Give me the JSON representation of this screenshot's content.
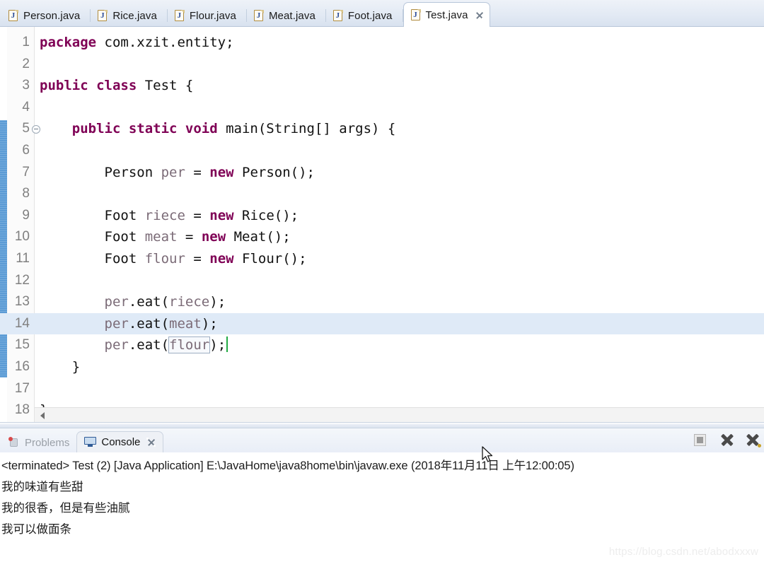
{
  "editor": {
    "tabs": [
      {
        "label": "Person.java",
        "icon": "java-file-icon",
        "active": false
      },
      {
        "label": "Rice.java",
        "icon": "java-file-icon",
        "active": false
      },
      {
        "label": "Flour.java",
        "icon": "java-file-icon",
        "active": false
      },
      {
        "label": "Meat.java",
        "icon": "java-file-icon",
        "active": false
      },
      {
        "label": "Foot.java",
        "icon": "java-file-icon",
        "active": false
      },
      {
        "label": "Test.java",
        "icon": "java-file-icon",
        "active": true,
        "close_icon": "close-icon"
      }
    ],
    "file_icon_letter": "J",
    "lines": [
      {
        "n": "1",
        "tokens": [
          {
            "t": "package",
            "c": "kw"
          },
          {
            "t": " com.xzit.entity;",
            "c": "pln"
          }
        ]
      },
      {
        "n": "2",
        "tokens": []
      },
      {
        "n": "3",
        "tokens": [
          {
            "t": "public class",
            "c": "kw"
          },
          {
            "t": " Test {",
            "c": "pln"
          }
        ]
      },
      {
        "n": "4",
        "tokens": []
      },
      {
        "n": "5",
        "fold": true,
        "tokens": [
          {
            "t": "    ",
            "c": "pln"
          },
          {
            "t": "public static void",
            "c": "kw"
          },
          {
            "t": " main(String[] args) {",
            "c": "pln"
          }
        ]
      },
      {
        "n": "6",
        "tokens": []
      },
      {
        "n": "7",
        "tokens": [
          {
            "t": "        Person ",
            "c": "pln"
          },
          {
            "t": "per",
            "c": "var"
          },
          {
            "t": " = ",
            "c": "pln"
          },
          {
            "t": "new",
            "c": "kw"
          },
          {
            "t": " Person();",
            "c": "pln"
          }
        ]
      },
      {
        "n": "8",
        "tokens": []
      },
      {
        "n": "9",
        "tokens": [
          {
            "t": "        Foot ",
            "c": "pln"
          },
          {
            "t": "riece",
            "c": "var"
          },
          {
            "t": " = ",
            "c": "pln"
          },
          {
            "t": "new",
            "c": "kw"
          },
          {
            "t": " Rice();",
            "c": "pln"
          }
        ]
      },
      {
        "n": "10",
        "tokens": [
          {
            "t": "        Foot ",
            "c": "pln"
          },
          {
            "t": "meat",
            "c": "var"
          },
          {
            "t": " = ",
            "c": "pln"
          },
          {
            "t": "new",
            "c": "kw"
          },
          {
            "t": " Meat();",
            "c": "pln"
          }
        ]
      },
      {
        "n": "11",
        "tokens": [
          {
            "t": "        Foot ",
            "c": "pln"
          },
          {
            "t": "flour",
            "c": "var"
          },
          {
            "t": " = ",
            "c": "pln"
          },
          {
            "t": "new",
            "c": "kw"
          },
          {
            "t": " Flour();",
            "c": "pln"
          }
        ]
      },
      {
        "n": "12",
        "tokens": []
      },
      {
        "n": "13",
        "tokens": [
          {
            "t": "        ",
            "c": "pln"
          },
          {
            "t": "per",
            "c": "var"
          },
          {
            "t": ".eat(",
            "c": "pln"
          },
          {
            "t": "riece",
            "c": "var"
          },
          {
            "t": ");",
            "c": "pln"
          }
        ]
      },
      {
        "n": "14",
        "highlight": true,
        "tokens": [
          {
            "t": "        ",
            "c": "pln"
          },
          {
            "t": "per",
            "c": "var"
          },
          {
            "t": ".eat(",
            "c": "pln"
          },
          {
            "t": "meat",
            "c": "var"
          },
          {
            "t": ");",
            "c": "pln"
          }
        ]
      },
      {
        "n": "15",
        "caret": true,
        "tokens": [
          {
            "t": "        ",
            "c": "pln"
          },
          {
            "t": "per",
            "c": "var"
          },
          {
            "t": ".eat(",
            "c": "pln"
          },
          {
            "t": "flour",
            "c": "var boxed"
          },
          {
            "t": ");",
            "c": "pln"
          }
        ]
      },
      {
        "n": "16",
        "tokens": [
          {
            "t": "    }",
            "c": "pln"
          }
        ]
      },
      {
        "n": "17",
        "tokens": []
      },
      {
        "n": "18",
        "tokens": [
          {
            "t": "}",
            "c": "pln"
          }
        ]
      }
    ]
  },
  "console": {
    "tabs": [
      {
        "label": "Problems",
        "icon": "problems-icon",
        "active": false
      },
      {
        "label": "Console",
        "icon": "console-monitor-icon",
        "active": true,
        "close_icon": "close-icon"
      }
    ],
    "toolbar": [
      {
        "name": "terminate-button",
        "icon": "stop-square-icon"
      },
      {
        "name": "remove-launch-button",
        "icon": "remove-x-icon"
      },
      {
        "name": "remove-all-terminated-button",
        "icon": "remove-all-x-icon"
      }
    ],
    "header": "<terminated> Test (2) [Java Application] E:\\JavaHome\\java8home\\bin\\javaw.exe (2018年11月11日 上午12:00:05)",
    "output": [
      "我的味道有些甜",
      "我的很香，但是有些油腻",
      "我可以做面条"
    ]
  },
  "watermark": "https://blog.csdn.net/abodxxxw",
  "colors": {
    "keyword": "#7f0055",
    "variable": "#7b6b77",
    "plain": "#111111",
    "line_highlight": "#dfeaf7",
    "change_bar": "#5b9bd5",
    "caret": "#22aa44",
    "tab_active_bg": "#ffffff"
  }
}
